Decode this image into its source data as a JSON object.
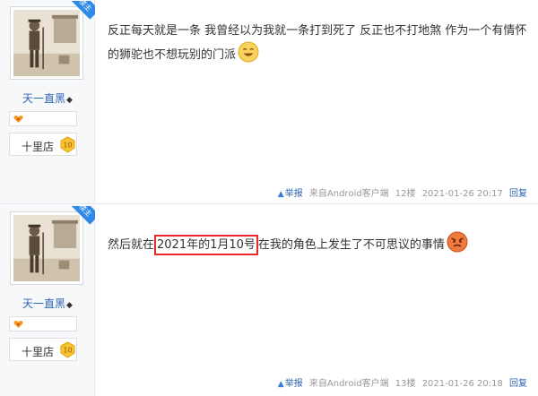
{
  "posts": [
    {
      "ribbon": "楼主",
      "user": {
        "name": "天一直黑",
        "mark": "◆"
      },
      "shop": {
        "label": "十里店",
        "level": "10"
      },
      "content": {
        "text": "反正每天就是一条 我曾经以为我就一条打到死了 反正也不打地煞 作为一个有情怀的狮驼也不想玩别的门派"
      },
      "meta": {
        "report": "举报",
        "source": "来自Android客户端",
        "floor": "12楼",
        "time": "2021-01-26 20:17",
        "reply": "回复"
      }
    },
    {
      "ribbon": "楼主",
      "user": {
        "name": "天一直黑",
        "mark": "◆"
      },
      "shop": {
        "label": "十里店",
        "level": "10"
      },
      "content": {
        "pre": "然后就在",
        "highlight": "2021年的1月10号",
        "post": "在我的角色上发生了不可思议的事情"
      },
      "meta": {
        "report": "举报",
        "source": "来自Android客户端",
        "floor": "13楼",
        "time": "2021-01-26 20:18",
        "reply": "回复"
      }
    }
  ],
  "colors": {
    "link": "#2d64b3",
    "ribbon": "#2e8ae6",
    "highlight_border": "#e8292b"
  },
  "icons": [
    "avatar-image",
    "favorite-icon",
    "level-badge-icon",
    "smile-emoji-icon",
    "angry-emoji-icon",
    "report-icon"
  ]
}
